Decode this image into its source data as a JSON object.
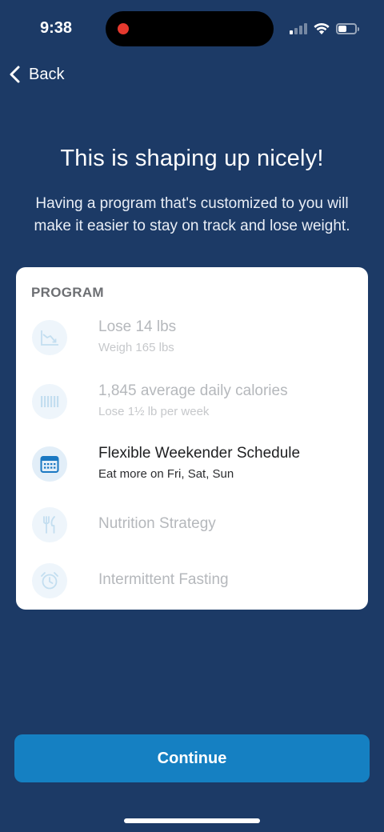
{
  "status_bar": {
    "time": "9:38",
    "battery_level": 0.45,
    "signal_bars_active": 1,
    "signal_bars_total": 4
  },
  "nav": {
    "back_label": "Back"
  },
  "header": {
    "title": "This is shaping up nicely!",
    "subtitle": "Having a program that's customized to you will make it easier to stay on track and lose weight."
  },
  "program": {
    "heading": "PROGRAM",
    "items": [
      {
        "icon": "weight-trend-icon",
        "title": "Lose 14 lbs",
        "subtitle": "Weigh 165 lbs",
        "state": "completed"
      },
      {
        "icon": "calories-bars-icon",
        "title": "1,845 average daily calories",
        "subtitle": "Lose 1½ lb per week",
        "state": "completed"
      },
      {
        "icon": "calendar-icon",
        "title": "Flexible Weekender Schedule",
        "subtitle": "Eat more on Fri, Sat, Sun",
        "state": "active"
      },
      {
        "icon": "fork-knife-icon",
        "title": "Nutrition Strategy",
        "state": "pending"
      },
      {
        "icon": "alarm-clock-icon",
        "title": "Intermittent Fasting",
        "state": "pending"
      }
    ]
  },
  "footer": {
    "continue_label": "Continue"
  },
  "colors": {
    "background": "#1c3a66",
    "button": "#1580c2",
    "card": "#ffffff",
    "icon_faded": "#bfdcef",
    "icon_active": "#1a78c2"
  }
}
